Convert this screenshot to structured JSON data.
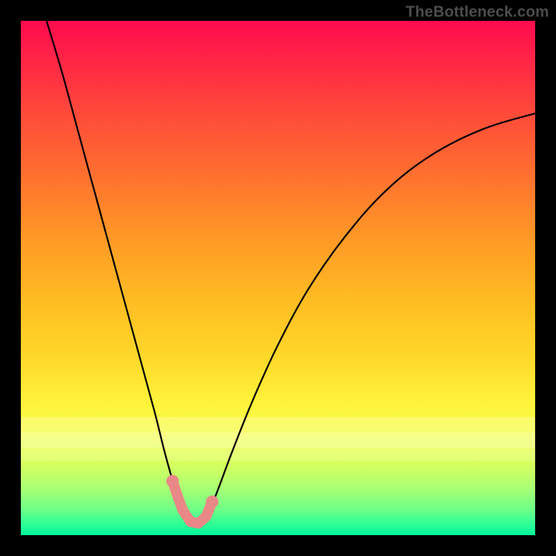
{
  "attribution": "TheBottleneck.com",
  "chart_data": {
    "type": "line",
    "title": "",
    "xlabel": "",
    "ylabel": "",
    "xlim": [
      0,
      100
    ],
    "ylim": [
      0,
      100
    ],
    "series": [
      {
        "name": "bottleneck-curve",
        "x": [
          5,
          8,
          11,
          14,
          17,
          20,
          23,
          26,
          28,
          30,
          31.5,
          33,
          34.5,
          36,
          38,
          41,
          45,
          50,
          56,
          63,
          71,
          80,
          90,
          100
        ],
        "y": [
          100,
          90,
          79,
          68,
          57,
          46,
          35,
          24,
          16,
          9,
          5,
          2.5,
          2.2,
          3.5,
          8,
          16,
          26,
          37,
          48,
          58,
          67,
          74,
          79,
          82
        ]
      }
    ],
    "markers": {
      "name": "highlight-region",
      "points": [
        {
          "x": 29.5,
          "y": 10.5
        },
        {
          "x": 30.5,
          "y": 7.5
        },
        {
          "x": 31.5,
          "y": 4.8
        },
        {
          "x": 33.0,
          "y": 2.6
        },
        {
          "x": 34.5,
          "y": 2.3
        },
        {
          "x": 36.0,
          "y": 3.6
        },
        {
          "x": 37.2,
          "y": 6.5
        }
      ]
    }
  }
}
